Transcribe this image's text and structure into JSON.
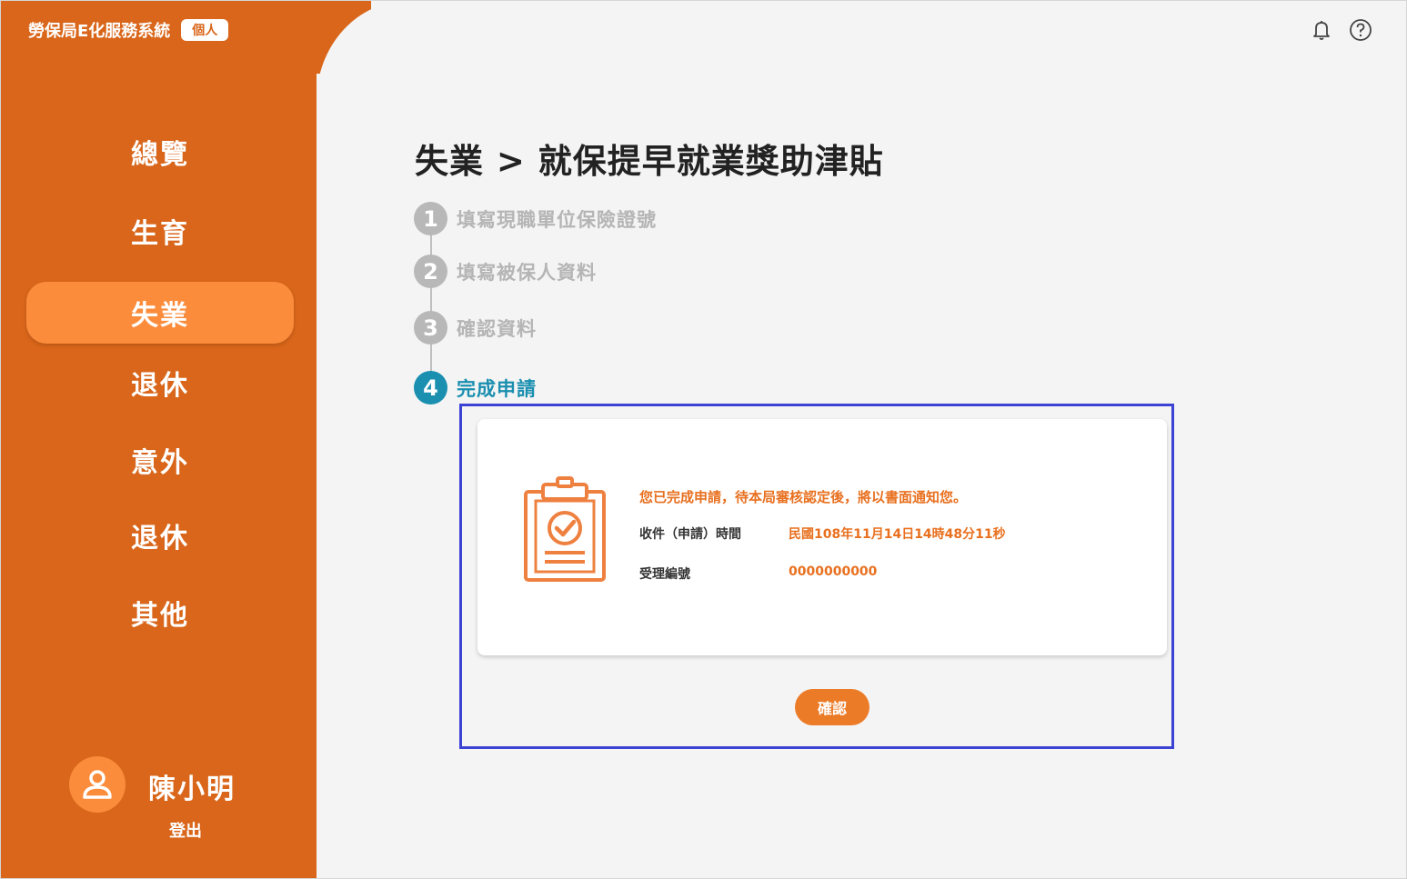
{
  "brand": {
    "title": "勞保局E化服務系統",
    "badge": "個人"
  },
  "sidebar": {
    "items": [
      {
        "label": "總覽",
        "active": false
      },
      {
        "label": "生育",
        "active": false
      },
      {
        "label": "失業",
        "active": true
      },
      {
        "label": "退休",
        "active": false
      },
      {
        "label": "意外",
        "active": false
      },
      {
        "label": "退休",
        "active": false
      },
      {
        "label": "其他",
        "active": false
      }
    ]
  },
  "user": {
    "name": "陳小明",
    "logout_label": "登出",
    "avatar_icon": "user-icon"
  },
  "header": {
    "icons": [
      "bell-icon",
      "help-icon"
    ]
  },
  "main": {
    "title": "失業 > 就保提早就業獎助津貼",
    "steps": [
      {
        "number": "1",
        "label": "填寫現職單位保險證號",
        "state": "done"
      },
      {
        "number": "2",
        "label": "填寫被保人資料",
        "state": "done"
      },
      {
        "number": "3",
        "label": "確認資料",
        "state": "done"
      },
      {
        "number": "4",
        "label": "完成申請",
        "state": "current"
      }
    ],
    "result": {
      "icon": "clipboard-check-icon",
      "message": "您已完成申請，待本局審核認定後，將以書面通知您。",
      "received_time_label": "收件（申請）時間",
      "received_time_value": "民國108年11月14日14時48分11秒",
      "case_number_label": "受理編號",
      "case_number_value": "0000000000"
    },
    "confirm_label": "確認"
  },
  "colors": {
    "sidebar": "#d9661a",
    "active_item": "#fb8c3c",
    "accent_orange": "#e8701f",
    "current_step": "#1b8fb0",
    "highlight_border": "#3b42d4"
  }
}
